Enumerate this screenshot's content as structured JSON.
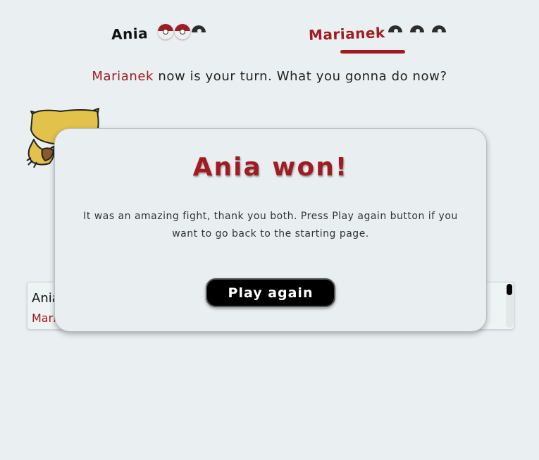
{
  "header": {
    "player1": {
      "name": "Ania",
      "pokeballs": [
        "full",
        "full",
        "empty"
      ]
    },
    "player2": {
      "name": "Marianek",
      "pokeballs": [
        "empty",
        "empty",
        "empty"
      ]
    }
  },
  "turn_message": {
    "player": "Marianek",
    "text": " now is your turn. What you gonna do now?"
  },
  "battle_log": {
    "line1": "Ania",
    "line2": "Mari"
  },
  "modal": {
    "title": "Ania won!",
    "text": "It was an amazing fight, thank you both. Press Play again button if you want to go back to the starting page.",
    "button_label": "Play again"
  },
  "colors": {
    "accent": "#a01c22",
    "background": "#eaf0f1",
    "button": "#000000"
  },
  "icons": {
    "pokeball": "pokeball-icon",
    "pokemon": "abra-sprite"
  }
}
